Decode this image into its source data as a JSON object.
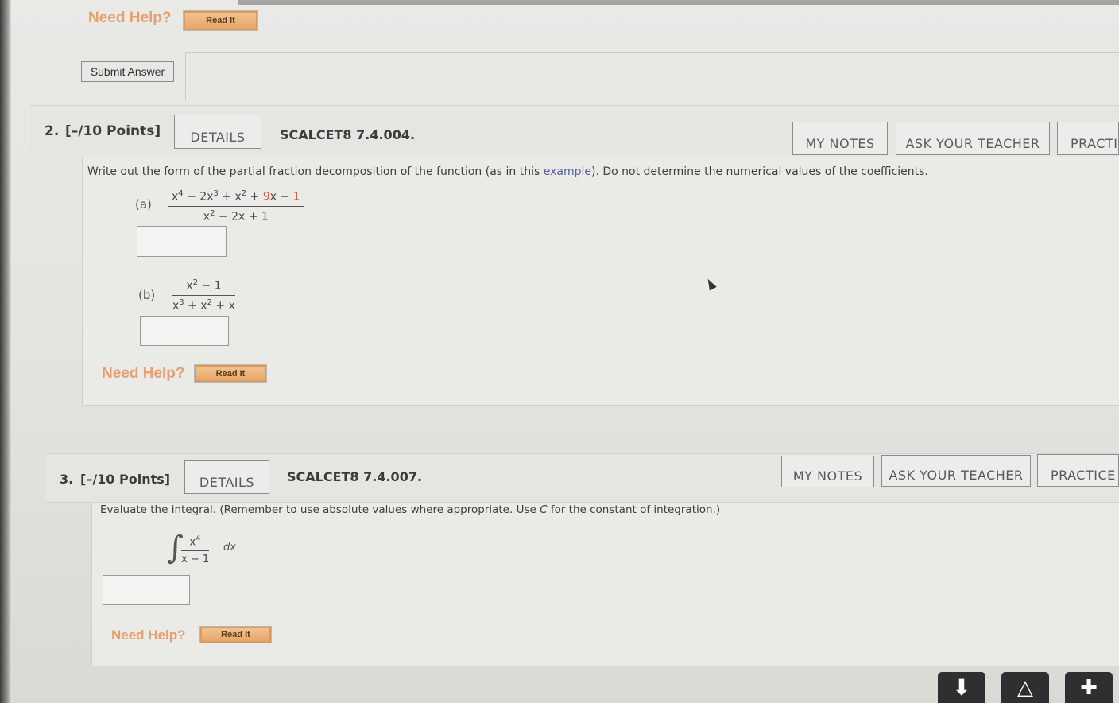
{
  "prev": {
    "need_help": "Need Help?",
    "read_it": "Read It",
    "submit": "Submit Answer"
  },
  "q2": {
    "number": "2.",
    "points": "[–/10 Points]",
    "details": "DETAILS",
    "code": "SCALCET8 7.4.004.",
    "my_notes": "MY NOTES",
    "ask_teacher": "ASK YOUR TEACHER",
    "practice": "PRACTICE ANOTHER",
    "prompt_before": "Write out the form of the partial fraction decomposition of the function (as in this ",
    "prompt_link": "example",
    "prompt_after": "). Do not determine the numerical values of the coefficients.",
    "part_a": "(a)",
    "part_b": "(b)",
    "need_help": "Need Help?",
    "read_it": "Read It"
  },
  "q3": {
    "number": "3.",
    "points": "[–/10 Points]",
    "details": "DETAILS",
    "code": "SCALCET8 7.4.007.",
    "my_notes": "MY NOTES",
    "ask_teacher": "ASK YOUR TEACHER",
    "practice": "PRACTICE ANOTHER",
    "prompt_before": "Evaluate the integral. (Remember to use absolute values where appropriate. Use ",
    "prompt_var": "C",
    "prompt_after": " for the constant of integration.)",
    "dx": "dx",
    "need_help": "Need Help?",
    "read_it": "Read It"
  },
  "dock": {
    "download_icon": "download-arrow-icon",
    "drive_icon": "drive-add-icon",
    "extension_icon": "app-add-icon"
  }
}
